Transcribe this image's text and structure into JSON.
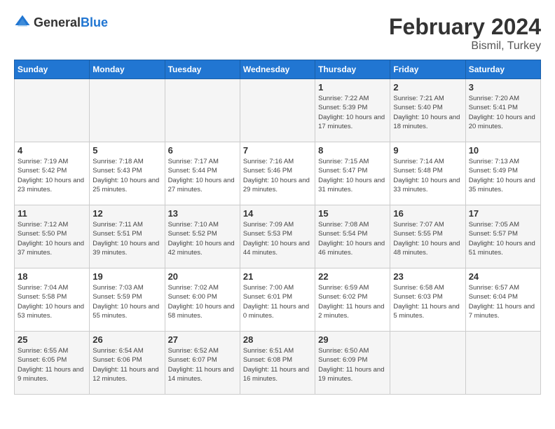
{
  "header": {
    "logo_general": "General",
    "logo_blue": "Blue",
    "main_title": "February 2024",
    "subtitle": "Bismil, Turkey"
  },
  "days_of_week": [
    "Sunday",
    "Monday",
    "Tuesday",
    "Wednesday",
    "Thursday",
    "Friday",
    "Saturday"
  ],
  "weeks": [
    [
      {
        "day": "",
        "info": ""
      },
      {
        "day": "",
        "info": ""
      },
      {
        "day": "",
        "info": ""
      },
      {
        "day": "",
        "info": ""
      },
      {
        "day": "1",
        "sunrise": "Sunrise: 7:22 AM",
        "sunset": "Sunset: 5:39 PM",
        "daylight": "Daylight: 10 hours and 17 minutes."
      },
      {
        "day": "2",
        "sunrise": "Sunrise: 7:21 AM",
        "sunset": "Sunset: 5:40 PM",
        "daylight": "Daylight: 10 hours and 18 minutes."
      },
      {
        "day": "3",
        "sunrise": "Sunrise: 7:20 AM",
        "sunset": "Sunset: 5:41 PM",
        "daylight": "Daylight: 10 hours and 20 minutes."
      }
    ],
    [
      {
        "day": "4",
        "sunrise": "Sunrise: 7:19 AM",
        "sunset": "Sunset: 5:42 PM",
        "daylight": "Daylight: 10 hours and 23 minutes."
      },
      {
        "day": "5",
        "sunrise": "Sunrise: 7:18 AM",
        "sunset": "Sunset: 5:43 PM",
        "daylight": "Daylight: 10 hours and 25 minutes."
      },
      {
        "day": "6",
        "sunrise": "Sunrise: 7:17 AM",
        "sunset": "Sunset: 5:44 PM",
        "daylight": "Daylight: 10 hours and 27 minutes."
      },
      {
        "day": "7",
        "sunrise": "Sunrise: 7:16 AM",
        "sunset": "Sunset: 5:46 PM",
        "daylight": "Daylight: 10 hours and 29 minutes."
      },
      {
        "day": "8",
        "sunrise": "Sunrise: 7:15 AM",
        "sunset": "Sunset: 5:47 PM",
        "daylight": "Daylight: 10 hours and 31 minutes."
      },
      {
        "day": "9",
        "sunrise": "Sunrise: 7:14 AM",
        "sunset": "Sunset: 5:48 PM",
        "daylight": "Daylight: 10 hours and 33 minutes."
      },
      {
        "day": "10",
        "sunrise": "Sunrise: 7:13 AM",
        "sunset": "Sunset: 5:49 PM",
        "daylight": "Daylight: 10 hours and 35 minutes."
      }
    ],
    [
      {
        "day": "11",
        "sunrise": "Sunrise: 7:12 AM",
        "sunset": "Sunset: 5:50 PM",
        "daylight": "Daylight: 10 hours and 37 minutes."
      },
      {
        "day": "12",
        "sunrise": "Sunrise: 7:11 AM",
        "sunset": "Sunset: 5:51 PM",
        "daylight": "Daylight: 10 hours and 39 minutes."
      },
      {
        "day": "13",
        "sunrise": "Sunrise: 7:10 AM",
        "sunset": "Sunset: 5:52 PM",
        "daylight": "Daylight: 10 hours and 42 minutes."
      },
      {
        "day": "14",
        "sunrise": "Sunrise: 7:09 AM",
        "sunset": "Sunset: 5:53 PM",
        "daylight": "Daylight: 10 hours and 44 minutes."
      },
      {
        "day": "15",
        "sunrise": "Sunrise: 7:08 AM",
        "sunset": "Sunset: 5:54 PM",
        "daylight": "Daylight: 10 hours and 46 minutes."
      },
      {
        "day": "16",
        "sunrise": "Sunrise: 7:07 AM",
        "sunset": "Sunset: 5:55 PM",
        "daylight": "Daylight: 10 hours and 48 minutes."
      },
      {
        "day": "17",
        "sunrise": "Sunrise: 7:05 AM",
        "sunset": "Sunset: 5:57 PM",
        "daylight": "Daylight: 10 hours and 51 minutes."
      }
    ],
    [
      {
        "day": "18",
        "sunrise": "Sunrise: 7:04 AM",
        "sunset": "Sunset: 5:58 PM",
        "daylight": "Daylight: 10 hours and 53 minutes."
      },
      {
        "day": "19",
        "sunrise": "Sunrise: 7:03 AM",
        "sunset": "Sunset: 5:59 PM",
        "daylight": "Daylight: 10 hours and 55 minutes."
      },
      {
        "day": "20",
        "sunrise": "Sunrise: 7:02 AM",
        "sunset": "Sunset: 6:00 PM",
        "daylight": "Daylight: 10 hours and 58 minutes."
      },
      {
        "day": "21",
        "sunrise": "Sunrise: 7:00 AM",
        "sunset": "Sunset: 6:01 PM",
        "daylight": "Daylight: 11 hours and 0 minutes."
      },
      {
        "day": "22",
        "sunrise": "Sunrise: 6:59 AM",
        "sunset": "Sunset: 6:02 PM",
        "daylight": "Daylight: 11 hours and 2 minutes."
      },
      {
        "day": "23",
        "sunrise": "Sunrise: 6:58 AM",
        "sunset": "Sunset: 6:03 PM",
        "daylight": "Daylight: 11 hours and 5 minutes."
      },
      {
        "day": "24",
        "sunrise": "Sunrise: 6:57 AM",
        "sunset": "Sunset: 6:04 PM",
        "daylight": "Daylight: 11 hours and 7 minutes."
      }
    ],
    [
      {
        "day": "25",
        "sunrise": "Sunrise: 6:55 AM",
        "sunset": "Sunset: 6:05 PM",
        "daylight": "Daylight: 11 hours and 9 minutes."
      },
      {
        "day": "26",
        "sunrise": "Sunrise: 6:54 AM",
        "sunset": "Sunset: 6:06 PM",
        "daylight": "Daylight: 11 hours and 12 minutes."
      },
      {
        "day": "27",
        "sunrise": "Sunrise: 6:52 AM",
        "sunset": "Sunset: 6:07 PM",
        "daylight": "Daylight: 11 hours and 14 minutes."
      },
      {
        "day": "28",
        "sunrise": "Sunrise: 6:51 AM",
        "sunset": "Sunset: 6:08 PM",
        "daylight": "Daylight: 11 hours and 16 minutes."
      },
      {
        "day": "29",
        "sunrise": "Sunrise: 6:50 AM",
        "sunset": "Sunset: 6:09 PM",
        "daylight": "Daylight: 11 hours and 19 minutes."
      },
      {
        "day": "",
        "info": ""
      },
      {
        "day": "",
        "info": ""
      }
    ]
  ]
}
